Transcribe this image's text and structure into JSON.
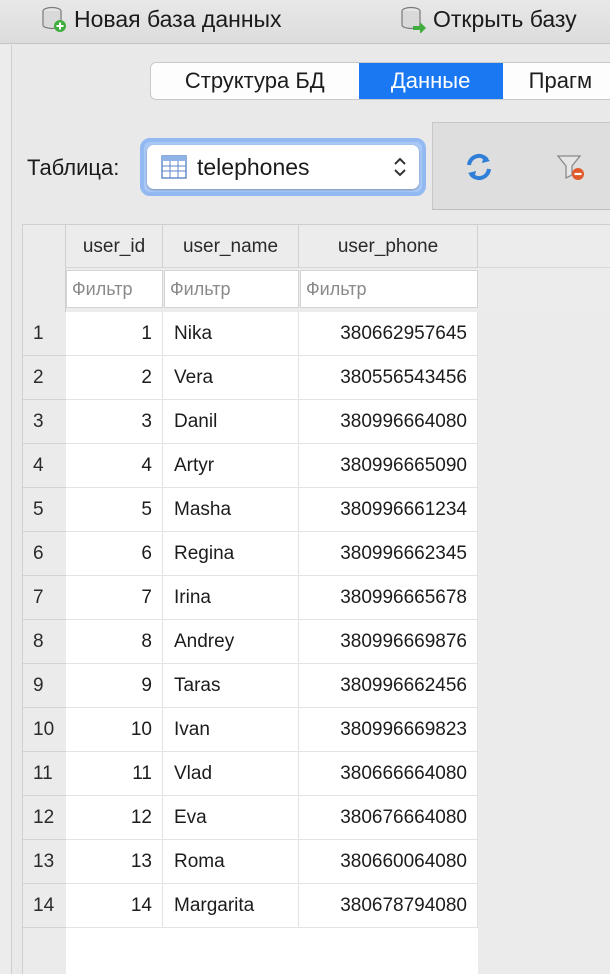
{
  "toolbar": {
    "new_db_label": "Новая база данных",
    "open_db_label": "Открыть базу"
  },
  "tabs": [
    {
      "label": "Структура БД",
      "active": false
    },
    {
      "label": "Данные",
      "active": true
    },
    {
      "label": "Прагм",
      "active": false
    }
  ],
  "table_selector": {
    "label": "Таблица:",
    "selected": "telephones"
  },
  "grid": {
    "columns": [
      "user_id",
      "user_name",
      "user_phone"
    ],
    "filter_placeholder": "Фильтр",
    "rows": [
      {
        "num": "1",
        "user_id": "1",
        "user_name": "Nika",
        "user_phone": "380662957645"
      },
      {
        "num": "2",
        "user_id": "2",
        "user_name": "Vera",
        "user_phone": "380556543456"
      },
      {
        "num": "3",
        "user_id": "3",
        "user_name": "Danil",
        "user_phone": "380996664080"
      },
      {
        "num": "4",
        "user_id": "4",
        "user_name": "Artyr",
        "user_phone": "380996665090"
      },
      {
        "num": "5",
        "user_id": "5",
        "user_name": "Masha",
        "user_phone": "380996661234"
      },
      {
        "num": "6",
        "user_id": "6",
        "user_name": "Regina",
        "user_phone": "380996662345"
      },
      {
        "num": "7",
        "user_id": "7",
        "user_name": "Irina",
        "user_phone": "380996665678"
      },
      {
        "num": "8",
        "user_id": "8",
        "user_name": "Andrey",
        "user_phone": "380996669876"
      },
      {
        "num": "9",
        "user_id": "9",
        "user_name": "Taras",
        "user_phone": "380996662456"
      },
      {
        "num": "10",
        "user_id": "10",
        "user_name": "Ivan",
        "user_phone": "380996669823"
      },
      {
        "num": "11",
        "user_id": "11",
        "user_name": "Vlad",
        "user_phone": "380666664080"
      },
      {
        "num": "12",
        "user_id": "12",
        "user_name": "Eva",
        "user_phone": "380676664080"
      },
      {
        "num": "13",
        "user_id": "13",
        "user_name": "Roma",
        "user_phone": "380660064080"
      },
      {
        "num": "14",
        "user_id": "14",
        "user_name": "Margarita",
        "user_phone": "380678794080"
      }
    ]
  },
  "icons": {
    "new_db": "database-add-icon",
    "open_db": "database-open-icon",
    "table": "table-icon",
    "select_chevron": "chevron-updown-icon",
    "refresh": "refresh-icon",
    "clear_filter": "clear-filter-icon"
  },
  "colors": {
    "accent": "#1a78f2",
    "focus_ring": "#93b9f3"
  }
}
